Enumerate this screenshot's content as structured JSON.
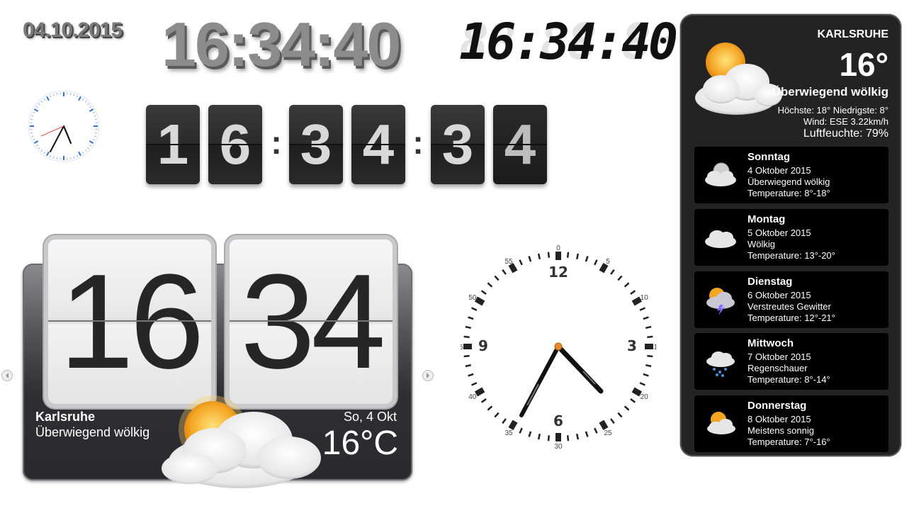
{
  "date_text": "04.10.2015",
  "time_text": "16:34:40",
  "lcd": {
    "ghost": "88:88:88",
    "time": "16:34:40"
  },
  "flip_clock": {
    "digits": [
      "1",
      "6",
      "3",
      "4",
      "3",
      "4"
    ],
    "separators": [
      ":",
      ":"
    ]
  },
  "htc_widget": {
    "hours": "16",
    "minutes": "34",
    "city": "Karlsruhe",
    "condition": "Überwiegend wölkig",
    "day": "So, 4 Okt",
    "temperature": "16°C"
  },
  "analog_big": {
    "numerals": [
      "12",
      "3",
      "6",
      "9"
    ],
    "minute_labels": [
      "0",
      "5",
      "10",
      "15",
      "20",
      "25",
      "30",
      "35",
      "40",
      "45",
      "50",
      "55"
    ]
  },
  "weather_panel": {
    "city": "KARLSRUHE",
    "temperature": "16°",
    "condition": "Überwiegend wölkig",
    "high_low": "Höchste: 18° Niedrigste: 8°",
    "wind": "Wind: ESE 3.22km/h",
    "humidity": "Luftfeuchte: 79%",
    "forecast": [
      {
        "day": "Sonntag",
        "date": "4 Oktober 2015",
        "condition": "Überwiegend wölkig",
        "temp": "Temperature: 8°-18°",
        "icon": "moon-cloud-icon"
      },
      {
        "day": "Montag",
        "date": "5 Oktober 2015",
        "condition": "Wölkig",
        "temp": "Temperature: 13°-20°",
        "icon": "cloud-icon"
      },
      {
        "day": "Dienstag",
        "date": "6 Oktober 2015",
        "condition": "Verstreutes Gewitter",
        "temp": "Temperature: 12°-21°",
        "icon": "thunderstorm-icon"
      },
      {
        "day": "Mittwoch",
        "date": "7 Oktober 2015",
        "condition": "Regenschauer",
        "temp": "Temperature: 8°-14°",
        "icon": "rain-cloud-icon"
      },
      {
        "day": "Donnerstag",
        "date": "8 Oktober 2015",
        "condition": "Meistens sonnig",
        "temp": "Temperature: 7°-16°",
        "icon": "sun-cloud-icon"
      }
    ]
  },
  "colors": {
    "panel_bg": "#232323",
    "tile_bg": "#2b2b2b",
    "accent_orange": "#e38b2c",
    "tick_blue": "#2f6fd6"
  }
}
